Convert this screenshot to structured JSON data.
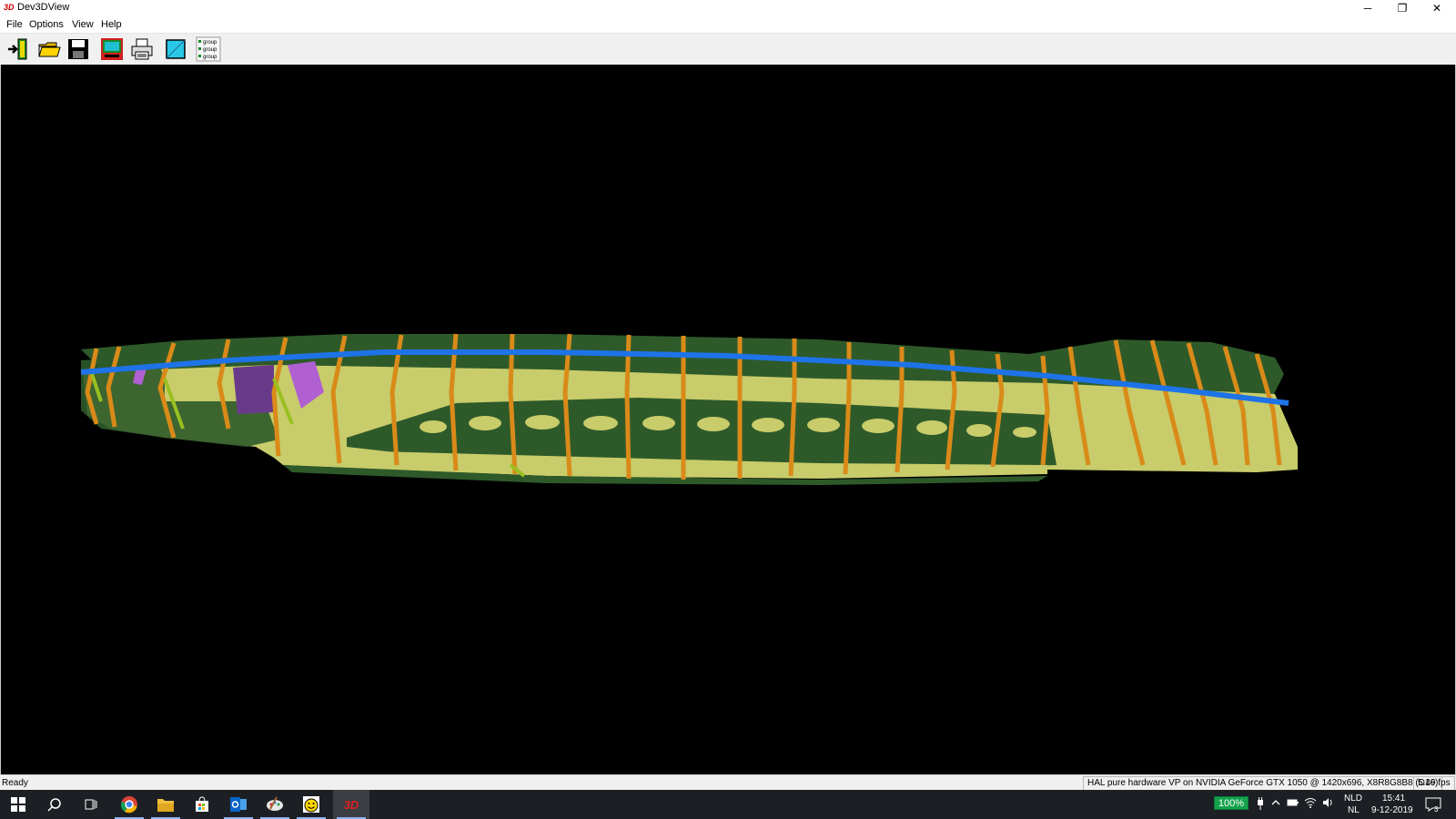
{
  "window": {
    "icon_label": "3D",
    "title": "Dev3DView",
    "minimize_glyph": "─",
    "maximize_glyph": "❐",
    "close_glyph": "✕"
  },
  "menu": {
    "items": [
      "File",
      "Options",
      "View",
      "Help"
    ]
  },
  "toolbar": {
    "buttons": [
      {
        "name": "exit",
        "icon": "exit-door-icon"
      },
      {
        "name": "open",
        "icon": "folder-open-icon"
      },
      {
        "name": "save",
        "icon": "floppy-disk-icon"
      },
      {
        "name": "screen",
        "icon": "monitor-icon"
      },
      {
        "name": "print",
        "icon": "printer-icon"
      },
      {
        "name": "background-color",
        "icon": "color-square-icon"
      },
      {
        "name": "groups",
        "icon": "group-list-icon"
      }
    ],
    "group_lines": [
      "group",
      "group",
      "group"
    ]
  },
  "viewport": {
    "background": "#000000",
    "model_colors": {
      "hull": "#c8cc6a",
      "dark_hull": "#2e5a2a",
      "frames": "#d98a18",
      "highlight_line": "#1e73e8",
      "purple": "#a050c0"
    }
  },
  "status": {
    "left_text": "Ready",
    "renderer_info": "HAL pure hardware VP on NVIDIA GeForce GTX 1050 @ 1420x696, X8R8G8B8 (D16)",
    "fps": "5.49 fps"
  },
  "taskbar": {
    "apps": [
      "start-icon",
      "search-icon",
      "task-view-icon",
      "chrome-icon",
      "file-explorer-icon",
      "store-icon",
      "outlook-icon",
      "paint-icon",
      "smiley-app-icon",
      "dev3dview-icon"
    ],
    "dev3dview_label": "3D",
    "battery_percent": "100%",
    "language_top": "NLD",
    "language_bottom": "NL",
    "time": "15:41",
    "date": "9-12-2019",
    "notification_count": "3"
  }
}
